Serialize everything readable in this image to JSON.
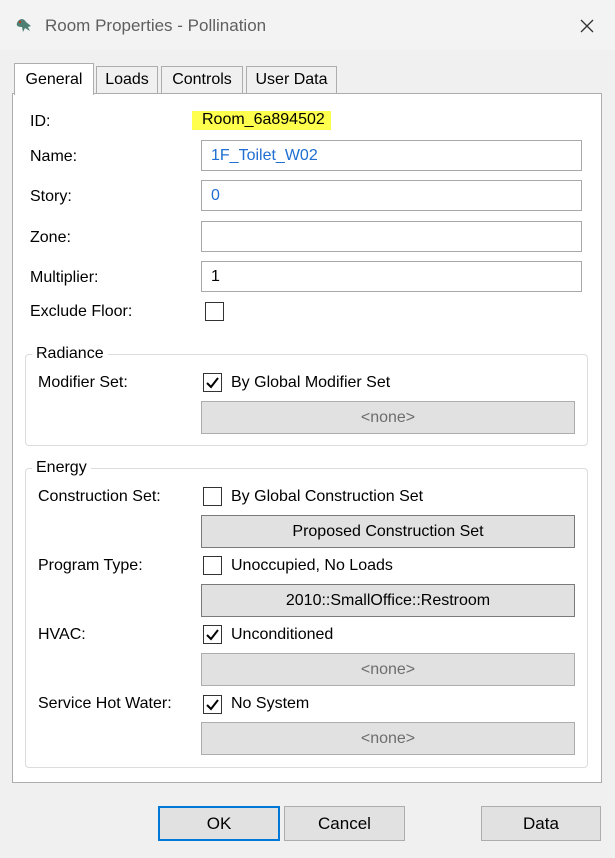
{
  "window": {
    "title": "Room Properties - Pollination"
  },
  "tabs": [
    "General",
    "Loads",
    "Controls",
    "User Data"
  ],
  "general": {
    "id_label": "ID:",
    "id_value": "Room_6a894502",
    "name_label": "Name:",
    "name_value": "1F_Toilet_W02",
    "story_label": "Story:",
    "story_value": "0",
    "zone_label": "Zone:",
    "zone_value": "",
    "multiplier_label": "Multiplier:",
    "multiplier_value": "1",
    "exclude_floor_label": "Exclude Floor:",
    "exclude_floor_checked": false
  },
  "radiance": {
    "title": "Radiance",
    "modifier_set_label": "Modifier Set:",
    "modifier_set_checkbox": "By Global Modifier Set",
    "modifier_set_checked": true,
    "modifier_set_button": "<none>"
  },
  "energy": {
    "title": "Energy",
    "construction_set_label": "Construction Set:",
    "construction_set_checkbox": "By Global Construction Set",
    "construction_set_checked": false,
    "construction_set_button": "Proposed Construction Set",
    "program_type_label": "Program Type:",
    "program_type_checkbox": "Unoccupied, No Loads",
    "program_type_checked": false,
    "program_type_button": "2010::SmallOffice::Restroom",
    "hvac_label": "HVAC:",
    "hvac_checkbox": "Unconditioned",
    "hvac_checked": true,
    "hvac_button": "<none>",
    "shw_label": "Service Hot Water:",
    "shw_checkbox": "No System",
    "shw_checked": true,
    "shw_button": "<none>"
  },
  "buttons": {
    "ok": "OK",
    "cancel": "Cancel",
    "data": "Data"
  },
  "colors": {
    "highlight": "#ffff4d",
    "link_text": "#1f6fd1",
    "default_button_border": "#0078d7"
  }
}
